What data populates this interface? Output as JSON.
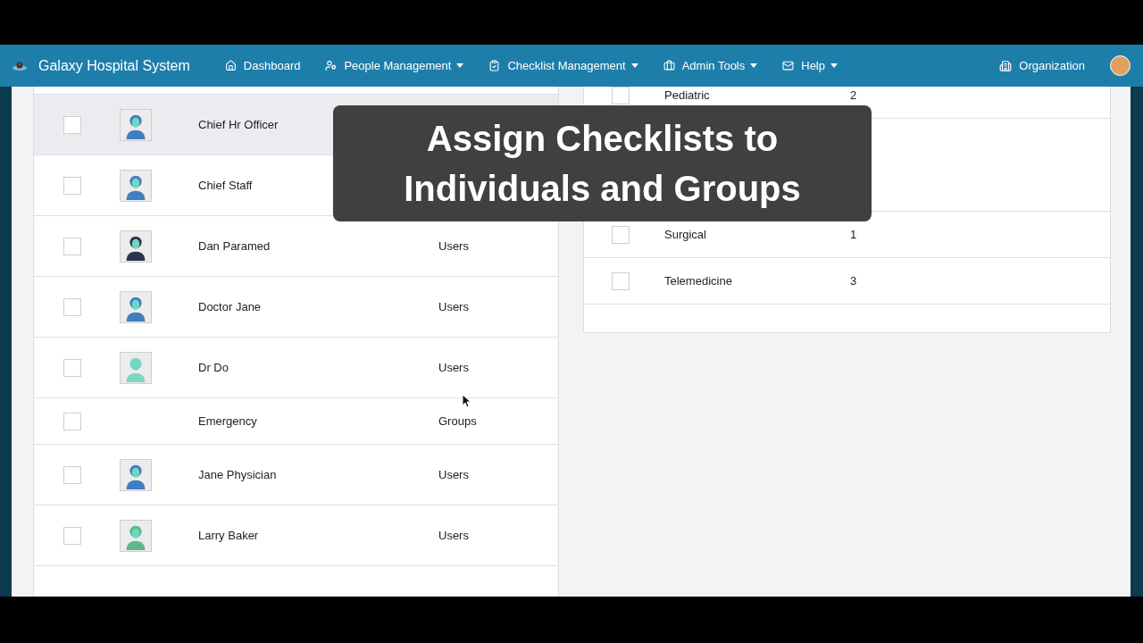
{
  "navbar": {
    "brand": "Galaxy Hospital System",
    "items": [
      {
        "kind": "home",
        "label": "Dashboard",
        "dropdown": false
      },
      {
        "kind": "people",
        "label": "People Management",
        "dropdown": true
      },
      {
        "kind": "checklist",
        "label": "Checklist Management",
        "dropdown": true
      },
      {
        "kind": "tools",
        "label": "Admin Tools",
        "dropdown": true
      },
      {
        "kind": "mail",
        "label": "Help",
        "dropdown": true
      }
    ],
    "organization": "Organization"
  },
  "assignees": {
    "rows": [
      {
        "name": "Chief Hr Officer",
        "color": "#3f7fc0",
        "highlighted": true,
        "checked": false
      },
      {
        "name": "Chief Staff",
        "color": "#3f7fc0",
        "highlighted": false,
        "checked": false
      },
      {
        "name": "Dan Paramed",
        "type": "Users",
        "color": "#2a3550",
        "highlighted": false,
        "checked": false
      },
      {
        "name": "Doctor Jane",
        "type": "Users",
        "color": "#3f7fc0",
        "highlighted": false,
        "checked": false
      },
      {
        "name": "Dr Do",
        "type": "Users",
        "color": "#7fd4c4",
        "highlighted": false,
        "checked": false
      },
      {
        "name": "Emergency",
        "type": "Groups",
        "highlighted": false,
        "checked": false
      },
      {
        "name": "Jane Physician",
        "type": "Users",
        "color": "#3f7fc0",
        "highlighted": false,
        "checked": false
      },
      {
        "name": "Larry Baker",
        "type": "Users",
        "color": "#5fb88a",
        "highlighted": false,
        "checked": false
      }
    ]
  },
  "groups": {
    "top_rows": [
      {
        "name": "Pediatric",
        "count": "2",
        "checked": false
      }
    ],
    "rows": [
      {
        "name": "Surgical",
        "count": "1",
        "checked": false
      },
      {
        "name": "Telemedicine",
        "count": "3",
        "checked": false
      }
    ]
  },
  "caption": "Assign Checklists to Individuals and Groups"
}
